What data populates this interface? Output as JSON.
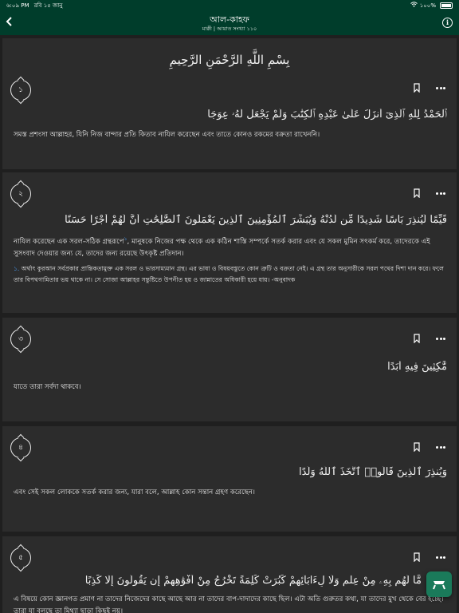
{
  "status": {
    "time": "৬:০৯ PM",
    "date": "রবি ১৫ জানু",
    "battery": "১০০%"
  },
  "header": {
    "title": "আল-কাহফ",
    "subtitle": "মাক্কী | আয়াত সংখ্যা ১১০"
  },
  "bismillah": "بِسْمِ اللَّهِ الرَّحْمَنِ الرَّحِيمِ",
  "verses": [
    {
      "number": "১",
      "arabic_a": "ٱلْحَمْدُ لِلَّهِ ٱلَّذِىٓ أَنزَلَ عَلَىٰ عَبْدِهِ ٱلْكِتَٰبَ وَلَمْ يَجْعَل لَّهُۥ عِوَجَا",
      "translation": "সমস্ত প্রশংসা আল্লাহর, যিনি নিজ বান্দার প্রতি কিতাব নাযিল করেছেন এবং তাতে কোনও রকমের বক্রতা রাখেননি।"
    },
    {
      "number": "২",
      "arabic_a": "قَيِّمًا لِّيُنذِرَ بَأْسًا شَدِيدًا مِّن لَّدُنْهُ وَيُبَشِّرَ ٱلْمُؤْمِنِينَ ٱلَّذِينَ يَعْمَلُونَ ٱلصَّٰلِحَٰتِ أَنَّ لَهُمْ أَجْرًا حَسَنًا",
      "translation_a": "নাযিল করেছেন এক সরল-সঠিক গ্রন্থরূপে",
      "translation_sup": "১",
      "translation_b": ", মানুষকে নিজের পক্ষ থেকে এক কঠিন শাস্তি সম্পর্কে সতর্ক করার এবং যে সকল মুমিন সৎকর্ম করে, তাদেরকে এই সুসংবাদ দেওয়ার জন্য যে, তাদের জন্য রয়েছে উৎকৃষ্ট প্রতিদান।",
      "note_number": "১.",
      "note": "অর্থাৎ কুরআন সর্বপ্রকার প্রান্তিকতামুক্ত এক সরল ও ভারসাম্যমান গ্রন্থ। এর ভাষা ও বিষয়বস্তুতে কোন ত্রুটি ও বক্রতা নেই। এ গ্রন্থ তার অনুসারীকে সরল পথের দিশা দান করে। ফলে তার বিপথগামিতার ভয় থাকে না। সে সোজা আল্লাহর সন্তুষ্টিতে উপনীত হয় ও জান্নাতের অধিকারী হয়ে যায়। -অনুবাদক"
    },
    {
      "number": "৩",
      "arabic_a": "مَّٰكِثِينَ فِيهِ أَبَدًا",
      "translation": "যাতে তারা সর্বদা থাকবে।"
    },
    {
      "number": "৪",
      "arabic_a": "وَيُنذِرَ ٱلَّذِينَ قَالُوا۟ ٱتَّخَذَ ٱللَّهُ وَلَدًا",
      "translation": "এবং সেই সকল লোককে সতর্ক করার জন্য, যারা বলে, আল্লাহ কোন সন্তান গ্রহণ করেছেন।"
    },
    {
      "number": "৫",
      "arabic_a": "مَّا لَهُم بِهِۦ مِنْ عِلْمٍ وَلَا لِءَابَآئِهِمْ كَبُرَتْ كَلِمَةً تَخْرُجُ مِنْ أَفْوَٰهِهِمْ إِن يَقُولُونَ إِلَّا كَذِبًا",
      "translation": "এ বিষয়ে কোন জ্ঞানগত প্রমাণ না তাদের নিজেদের কাছে আছে আর না তাদের বাপ-দাদাদের কাছে ছিল। এটা অতি গুরুতর কথা, যা তাদের মুখ থেকে বের হচ্ছে। তারা যা বলছে তা মিথ্যা ছাড়া কিছুই নয়।"
    }
  ]
}
